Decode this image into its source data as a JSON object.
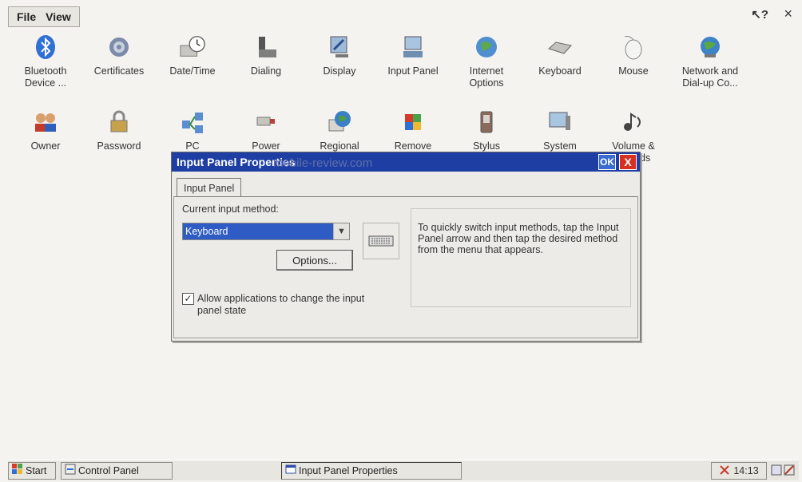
{
  "menu": {
    "file": "File",
    "view": "View"
  },
  "top_controls": {
    "help": "?",
    "close": "×"
  },
  "icons_row1": [
    {
      "label": "Bluetooth Device ...",
      "icon": "bluetooth-icon"
    },
    {
      "label": "Certificates",
      "icon": "gear-icon"
    },
    {
      "label": "Date/Time",
      "icon": "clock-icon"
    },
    {
      "label": "Dialing",
      "icon": "phone-icon"
    },
    {
      "label": "Display",
      "icon": "display-icon"
    },
    {
      "label": "Input Panel",
      "icon": "input-panel-icon"
    },
    {
      "label": "Internet Options",
      "icon": "globe-icon"
    },
    {
      "label": "Keyboard",
      "icon": "keyboard-icon"
    },
    {
      "label": "Mouse",
      "icon": "mouse-icon"
    },
    {
      "label": "Network and Dial-up Co...",
      "icon": "network-icon"
    }
  ],
  "icons_row2": [
    {
      "label": "Owner",
      "icon": "owner-icon"
    },
    {
      "label": "Password",
      "icon": "lock-icon"
    },
    {
      "label": "PC",
      "icon": "pc-icon"
    },
    {
      "label": "Power",
      "icon": "power-icon"
    },
    {
      "label": "Regional",
      "icon": "regional-icon"
    },
    {
      "label": "Remove",
      "icon": "remove-icon"
    },
    {
      "label": "Stylus",
      "icon": "stylus-icon"
    },
    {
      "label": "System",
      "icon": "system-icon"
    },
    {
      "label": "Volume & Sounds",
      "icon": "volume-icon"
    }
  ],
  "dialog": {
    "title": "Input Panel Properties",
    "ok": "OK",
    "close": "X",
    "tab": "Input Panel",
    "method_label": "Current input method:",
    "method_value": "Keyboard",
    "options_button": "Options...",
    "checkbox_label": "Allow applications to change the input panel state",
    "checkbox_checked": true,
    "info": "To quickly switch input methods, tap the Input Panel arrow and then tap the desired method from the menu that appears."
  },
  "watermark": "mobile-review.com",
  "taskbar": {
    "start": "Start",
    "control_panel": "Control Panel",
    "input_panel_props": "Input Panel Properties",
    "time": "14:13"
  }
}
